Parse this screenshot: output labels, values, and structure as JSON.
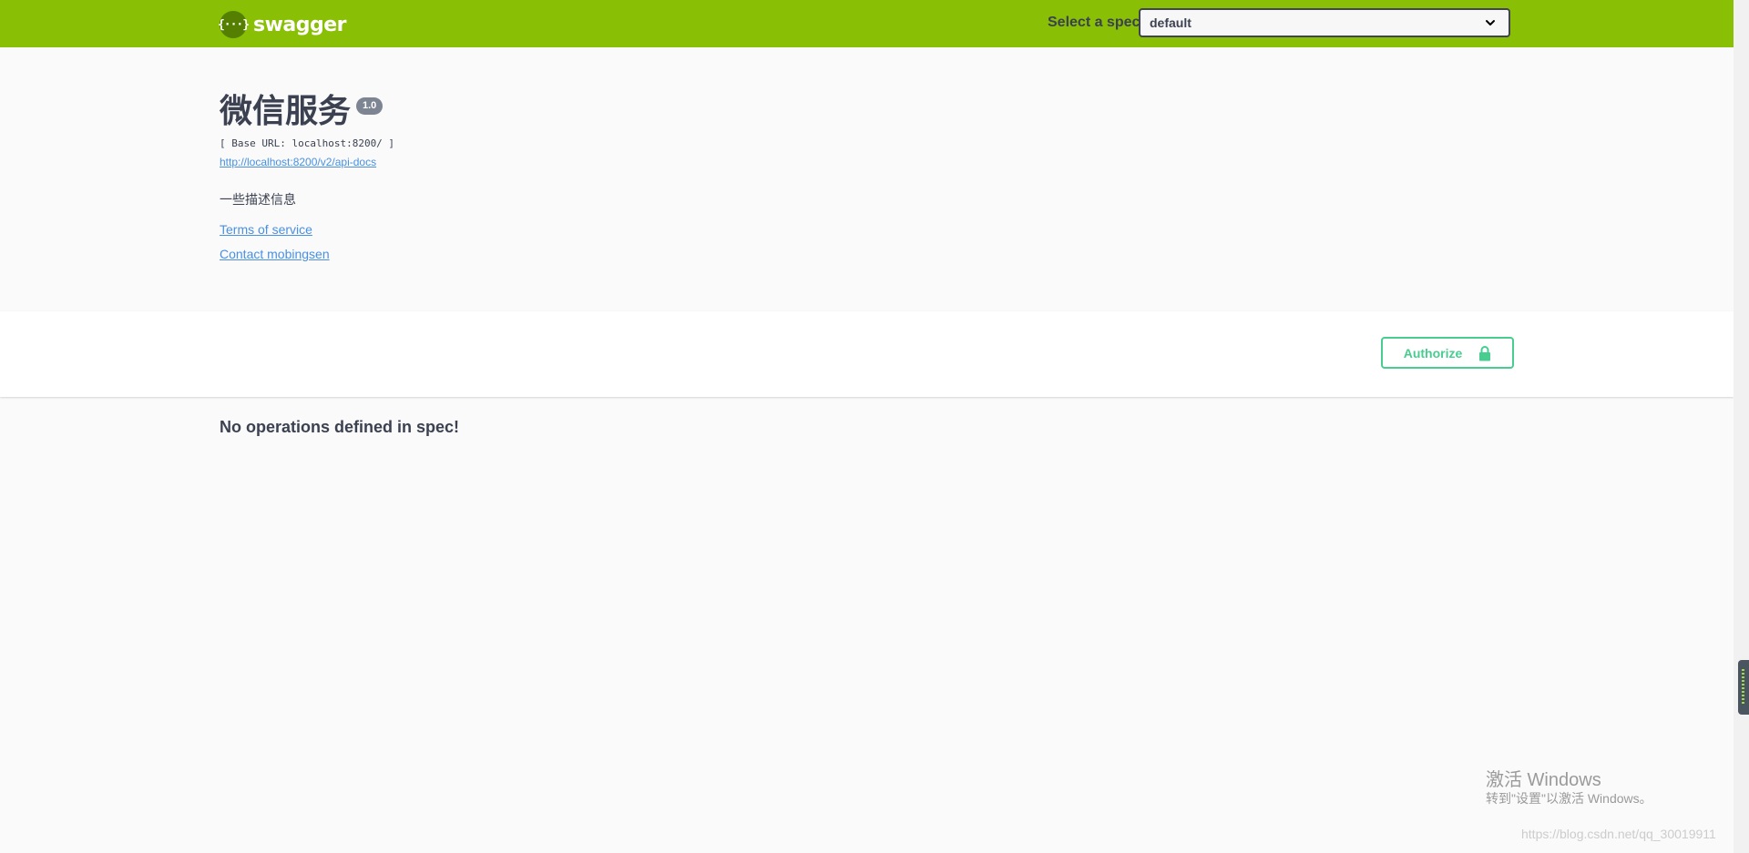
{
  "topbar": {
    "brand": "swagger",
    "logo_glyph": "{···}",
    "spec_label": "Select a spec",
    "spec_selected": "default",
    "background_color": "#89bf04"
  },
  "info": {
    "title": "微信服务",
    "version": "1.0",
    "base_url": "[ Base URL: localhost:8200/ ]",
    "api_docs_url": "http://localhost:8200/v2/api-docs",
    "description": "一些描述信息",
    "terms_link": "Terms of service",
    "contact_link": "Contact mobingsen"
  },
  "scheme": {
    "authorize_label": "Authorize",
    "authorize_icon": "lock-icon",
    "accent_color": "#49cc90"
  },
  "operations": {
    "empty_message": "No operations defined in spec!"
  },
  "watermarks": {
    "windows_activate": "激活 Windows",
    "windows_activate_sub": "转到\"设置\"以激活 Windows。",
    "blog_url": "https://blog.csdn.net/qq_30019911"
  }
}
